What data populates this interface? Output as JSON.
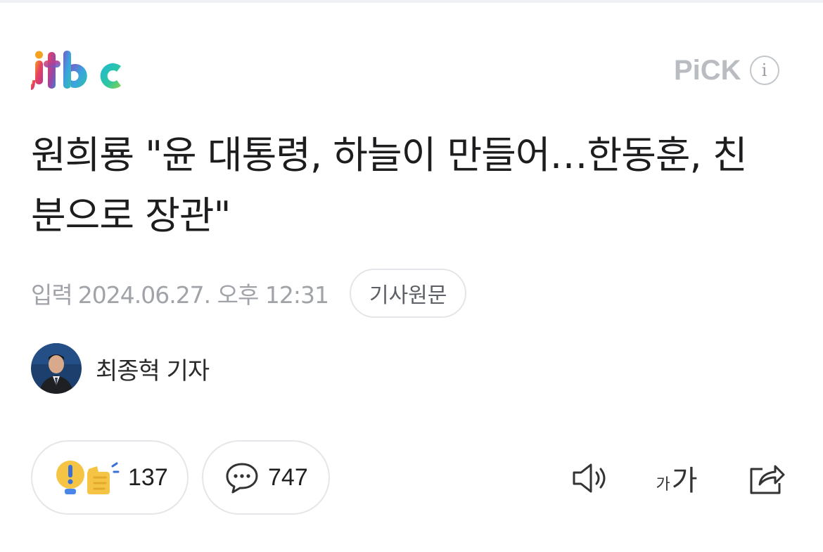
{
  "header": {
    "logo_text": "jtbc",
    "pick_label": "PiCK",
    "info_label": "i"
  },
  "article": {
    "title": "원희룡 \"윤 대통령, 하늘이 만들어…한동훈, 친분으로 장관\"",
    "date_label": "입력",
    "date_value": "2024.06.27. 오후 12:31",
    "source_button": "기사원문"
  },
  "author": {
    "name": "최종혁 기자"
  },
  "actions": {
    "reaction_count": "137",
    "comment_count": "747",
    "font_small": "가",
    "font_big": "가"
  },
  "colors": {
    "pick_gray": "#b9bcc1",
    "meta_gray": "#a0a3a8",
    "reaction_yellow": "#f5c445"
  }
}
